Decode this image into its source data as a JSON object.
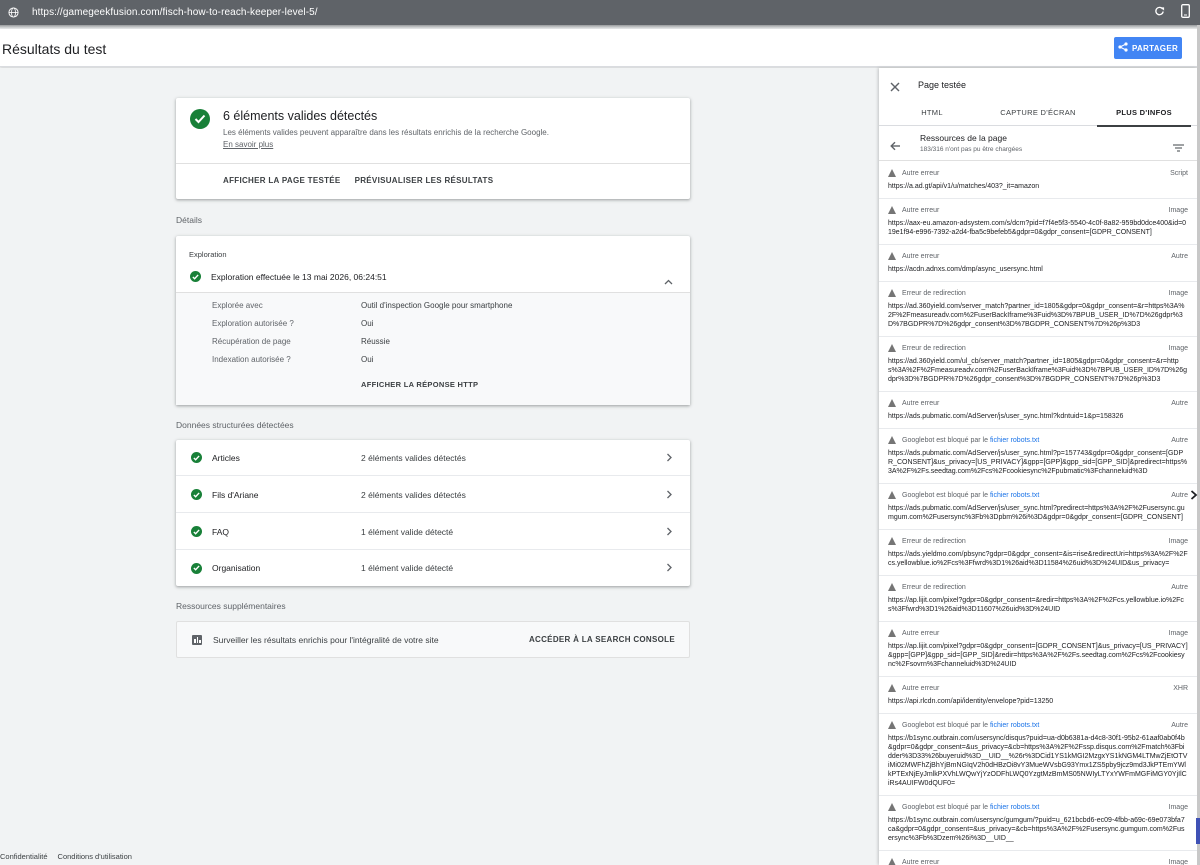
{
  "browser": {
    "url": "https://gamegeekfusion.com/fisch-how-to-reach-keeper-level-5/",
    "icons": [
      "globe-icon",
      "refresh-icon",
      "phone-icon"
    ]
  },
  "header": {
    "title": "Résultats du test",
    "share_label": "PARTAGER"
  },
  "summary": {
    "heading": "6 éléments valides détectés",
    "description": "Les éléments valides peuvent apparaître dans les résultats enrichis de la recherche Google.",
    "learn_more": "En savoir plus",
    "action_view_page": "AFFICHER LA PAGE TESTÉE",
    "action_preview": "PRÉVISUALISER LES RÉSULTATS"
  },
  "details": {
    "section_label": "Détails",
    "subsection": "Exploration",
    "crawl_status": "Exploration effectuée le 13 mai 2026, 06:24:51",
    "rows": [
      {
        "key": "Explorée avec",
        "value": "Outil d'inspection Google pour smartphone"
      },
      {
        "key": "Exploration autorisée ?",
        "value": "Oui"
      },
      {
        "key": "Récupération de page",
        "value": "Réussie"
      },
      {
        "key": "Indexation autorisée ?",
        "value": "Oui"
      }
    ],
    "http_action": "AFFICHER LA RÉPONSE HTTP"
  },
  "structured": {
    "section_label": "Données structurées détectées",
    "items": [
      {
        "name": "Articles",
        "value": "2 éléments valides détectés"
      },
      {
        "name": "Fils d'Ariane",
        "value": "2 éléments valides détectés"
      },
      {
        "name": "FAQ",
        "value": "1 élément valide détecté"
      },
      {
        "name": "Organisation",
        "value": "1 élément valide détecté"
      }
    ]
  },
  "extra": {
    "section_label": "Ressources supplémentaires",
    "text": "Surveiller les résultats enrichis pour l'intégralité de votre site",
    "action": "ACCÉDER À LA SEARCH CONSOLE"
  },
  "footer": {
    "privacy": "Confidentialité",
    "terms": "Conditions d'utilisation"
  },
  "panel": {
    "title": "Page testée",
    "tabs": [
      "HTML",
      "CAPTURE D'ÉCRAN",
      "PLUS D'INFOS"
    ],
    "resources_title": "Ressources de la page",
    "resources_sub": "183/316 n'ont pas pu être chargées",
    "resources": [
      {
        "status": "Autre erreur",
        "type": "Script",
        "url": "https://a.ad.gt/api/v1/u/matches/403?_it=amazon"
      },
      {
        "status": "Autre erreur",
        "type": "Image",
        "url": "https://aax-eu.amazon-adsystem.com/s/dcm?pid=f7f4e5f3-5540-4c0f-8a82-959bd0dce400&id=019e1f94-e996-7392-a2d4-fba5c9befeb5&gdpr=0&gdpr_consent=[GDPR_CONSENT]"
      },
      {
        "status": "Autre erreur",
        "type": "Autre",
        "url": "https://acdn.adnxs.com/dmp/async_usersync.html"
      },
      {
        "status": "Erreur de redirection",
        "type": "Image",
        "url": "https://ad.360yield.com/server_match?partner_id=1805&gdpr=0&gdpr_consent=&r=https%3A%2F%2Fmeasureadv.com%2FuserBackIframe%3Fuid%3D%7BPUB_USER_ID%7D%26gdpr%3D%7BGDPR%7D%26gdpr_consent%3D%7BGDPR_CONSENT%7D%26p%3D3"
      },
      {
        "status": "Erreur de redirection",
        "type": "Image",
        "url": "https://ad.360yield.com/ul_cb/server_match?partner_id=1805&gdpr=0&gdpr_consent=&r=https%3A%2F%2Fmeasureadv.com%2FuserBackIframe%3Fuid%3D%7BPUB_USER_ID%7D%26gdpr%3D%7BGDPR%7D%26gdpr_consent%3D%7BGDPR_CONSENT%7D%26p%3D3"
      },
      {
        "status": "Autre erreur",
        "type": "Autre",
        "url": "https://ads.pubmatic.com/AdServer/js/user_sync.html?kdntuid=1&p=158326"
      },
      {
        "status": "Googlebot est bloqué par le ",
        "status_link": "fichier robots.txt",
        "type": "Autre",
        "url": "https://ads.pubmatic.com/AdServer/js/user_sync.html?p=157743&gdpr=0&gdpr_consent=[GDPR_CONSENT]&us_privacy=[US_PRIVACY]&gpp=[GPP]&gpp_sid=[GPP_SID]&predirect=https%3A%2F%2Fs.seedtag.com%2Fcs%2Fcookiesync%2Fpubmatic%3Fchanneluid%3D"
      },
      {
        "status": "Googlebot est bloqué par le ",
        "status_link": "fichier robots.txt",
        "type": "Autre",
        "url": "https://ads.pubmatic.com/AdServer/js/user_sync.html?predirect=https%3A%2F%2Fusersync.gumgum.com%2Fusersync%3Fb%3Dpbm%26i%3D&gdpr=0&gdpr_consent=[GDPR_CONSENT]"
      },
      {
        "status": "Erreur de redirection",
        "type": "Image",
        "url": "https://ads.yieldmo.com/pbsync?gdpr=0&gdpr_consent=&is=rise&redirectUri=https%3A%2F%2Fcs.yellowblue.io%2Fcs%3Ffwrd%3D1%26aid%3D11584%26uid%3D%24UID&us_privacy="
      },
      {
        "status": "Erreur de redirection",
        "type": "Autre",
        "url": "https://ap.lijit.com/pixel?gdpr=0&gdpr_consent=&redir=https%3A%2F%2Fcs.yellowblue.io%2Fcs%3Ffwrd%3D1%26aid%3D11607%26uid%3D%24UID"
      },
      {
        "status": "Autre erreur",
        "type": "Image",
        "url": "https://ap.lijit.com/pixel?gdpr=0&gdpr_consent=[GDPR_CONSENT]&us_privacy=[US_PRIVACY]&gpp=[GPP]&gpp_sid=[GPP_SID]&redir=https%3A%2F%2Fs.seedtag.com%2Fcs%2Fcookiesync%2Fsovrn%3Fchanneluid%3D%24UID"
      },
      {
        "status": "Autre erreur",
        "type": "XHR",
        "url": "https://api.rlcdn.com/api/identity/envelope?pid=13250"
      },
      {
        "status": "Googlebot est bloqué par le ",
        "status_link": "fichier robots.txt",
        "type": "Autre",
        "url": "https://b1sync.outbrain.com/usersync/disqus?puid=ua-d0b6381a-d4c8-30f1-95b2-61aaf0ab0f4b&gdpr=0&gdpr_consent=&us_privacy=&cb=https%3A%2F%2Fssp.disqus.com%2Fmatch%3Fbidder%3D33%26buyeruid%3D__UID__%26r%3DCid1YS1kMGI2MzgxYS1kNGM4LTMwZjEtOTViMi02MWFhZjBhYjBmNGIqV2h0dHBzOi8vY3MueWVsbG93Ymx1ZS5pby9jcz9md3JkPTEmYWlkPTExNjEyJmlkPXVhLWQwYjYzODFhLWQ0YzgtMzBmMS05NWIyLTYxYWFmMGFiMGY0YjIlCiRs4AUIFW0dQUF0="
      },
      {
        "status": "Googlebot est bloqué par le ",
        "status_link": "fichier robots.txt",
        "type": "Image",
        "url": "https://b1sync.outbrain.com/usersync/gumgum/?puid=u_621bcbd6-ec09-4fbb-a69c-69e073bfa7ca&gdpr=0&gdpr_consent=&us_privacy=&cb=https%3A%2F%2Fusersync.gumgum.com%2Fusersync%3Fb%3Dzem%26i%3D__UID__"
      },
      {
        "status": "Autre erreur",
        "type": "Image",
        "url": ""
      }
    ]
  },
  "colors": {
    "accent": "#4285f4",
    "success": "#188038",
    "link": "#1a73e8",
    "urlbar": "#5f6368"
  }
}
